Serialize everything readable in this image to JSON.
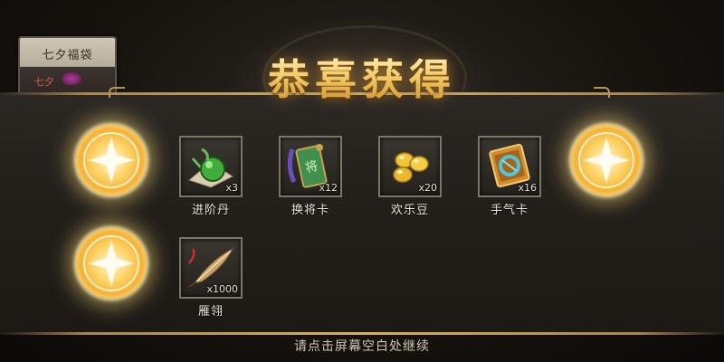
{
  "background_panel": {
    "title": "七夕福袋",
    "subtitle": "七夕"
  },
  "dialog": {
    "title": "恭喜获得",
    "continue_hint": "请点击屏幕空白处继续"
  },
  "rewards": [
    {
      "name": "进阶丹",
      "count": "x3",
      "icon": "green-pill-icon"
    },
    {
      "name": "换将卡",
      "count": "x12",
      "icon": "green-token-card-icon"
    },
    {
      "name": "欢乐豆",
      "count": "x20",
      "icon": "gold-beans-icon"
    },
    {
      "name": "手气卡",
      "count": "x16",
      "icon": "luck-card-icon"
    },
    {
      "name": "雁翎",
      "count": "x1000",
      "icon": "feather-icon"
    }
  ],
  "colors": {
    "title_gold": "#f2c45c",
    "band_trim": "#d2b06a",
    "item_text": "#ece6d8"
  }
}
